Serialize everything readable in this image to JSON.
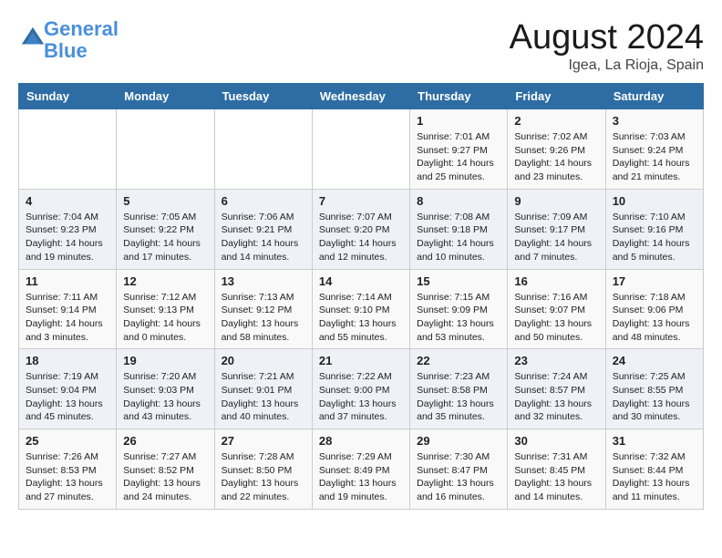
{
  "header": {
    "logo_line1": "General",
    "logo_line2": "Blue",
    "month": "August 2024",
    "location": "Igea, La Rioja, Spain"
  },
  "weekdays": [
    "Sunday",
    "Monday",
    "Tuesday",
    "Wednesday",
    "Thursday",
    "Friday",
    "Saturday"
  ],
  "weeks": [
    [
      {
        "day": "",
        "info": ""
      },
      {
        "day": "",
        "info": ""
      },
      {
        "day": "",
        "info": ""
      },
      {
        "day": "",
        "info": ""
      },
      {
        "day": "1",
        "info": "Sunrise: 7:01 AM\nSunset: 9:27 PM\nDaylight: 14 hours\nand 25 minutes."
      },
      {
        "day": "2",
        "info": "Sunrise: 7:02 AM\nSunset: 9:26 PM\nDaylight: 14 hours\nand 23 minutes."
      },
      {
        "day": "3",
        "info": "Sunrise: 7:03 AM\nSunset: 9:24 PM\nDaylight: 14 hours\nand 21 minutes."
      }
    ],
    [
      {
        "day": "4",
        "info": "Sunrise: 7:04 AM\nSunset: 9:23 PM\nDaylight: 14 hours\nand 19 minutes."
      },
      {
        "day": "5",
        "info": "Sunrise: 7:05 AM\nSunset: 9:22 PM\nDaylight: 14 hours\nand 17 minutes."
      },
      {
        "day": "6",
        "info": "Sunrise: 7:06 AM\nSunset: 9:21 PM\nDaylight: 14 hours\nand 14 minutes."
      },
      {
        "day": "7",
        "info": "Sunrise: 7:07 AM\nSunset: 9:20 PM\nDaylight: 14 hours\nand 12 minutes."
      },
      {
        "day": "8",
        "info": "Sunrise: 7:08 AM\nSunset: 9:18 PM\nDaylight: 14 hours\nand 10 minutes."
      },
      {
        "day": "9",
        "info": "Sunrise: 7:09 AM\nSunset: 9:17 PM\nDaylight: 14 hours\nand 7 minutes."
      },
      {
        "day": "10",
        "info": "Sunrise: 7:10 AM\nSunset: 9:16 PM\nDaylight: 14 hours\nand 5 minutes."
      }
    ],
    [
      {
        "day": "11",
        "info": "Sunrise: 7:11 AM\nSunset: 9:14 PM\nDaylight: 14 hours\nand 3 minutes."
      },
      {
        "day": "12",
        "info": "Sunrise: 7:12 AM\nSunset: 9:13 PM\nDaylight: 14 hours\nand 0 minutes."
      },
      {
        "day": "13",
        "info": "Sunrise: 7:13 AM\nSunset: 9:12 PM\nDaylight: 13 hours\nand 58 minutes."
      },
      {
        "day": "14",
        "info": "Sunrise: 7:14 AM\nSunset: 9:10 PM\nDaylight: 13 hours\nand 55 minutes."
      },
      {
        "day": "15",
        "info": "Sunrise: 7:15 AM\nSunset: 9:09 PM\nDaylight: 13 hours\nand 53 minutes."
      },
      {
        "day": "16",
        "info": "Sunrise: 7:16 AM\nSunset: 9:07 PM\nDaylight: 13 hours\nand 50 minutes."
      },
      {
        "day": "17",
        "info": "Sunrise: 7:18 AM\nSunset: 9:06 PM\nDaylight: 13 hours\nand 48 minutes."
      }
    ],
    [
      {
        "day": "18",
        "info": "Sunrise: 7:19 AM\nSunset: 9:04 PM\nDaylight: 13 hours\nand 45 minutes."
      },
      {
        "day": "19",
        "info": "Sunrise: 7:20 AM\nSunset: 9:03 PM\nDaylight: 13 hours\nand 43 minutes."
      },
      {
        "day": "20",
        "info": "Sunrise: 7:21 AM\nSunset: 9:01 PM\nDaylight: 13 hours\nand 40 minutes."
      },
      {
        "day": "21",
        "info": "Sunrise: 7:22 AM\nSunset: 9:00 PM\nDaylight: 13 hours\nand 37 minutes."
      },
      {
        "day": "22",
        "info": "Sunrise: 7:23 AM\nSunset: 8:58 PM\nDaylight: 13 hours\nand 35 minutes."
      },
      {
        "day": "23",
        "info": "Sunrise: 7:24 AM\nSunset: 8:57 PM\nDaylight: 13 hours\nand 32 minutes."
      },
      {
        "day": "24",
        "info": "Sunrise: 7:25 AM\nSunset: 8:55 PM\nDaylight: 13 hours\nand 30 minutes."
      }
    ],
    [
      {
        "day": "25",
        "info": "Sunrise: 7:26 AM\nSunset: 8:53 PM\nDaylight: 13 hours\nand 27 minutes."
      },
      {
        "day": "26",
        "info": "Sunrise: 7:27 AM\nSunset: 8:52 PM\nDaylight: 13 hours\nand 24 minutes."
      },
      {
        "day": "27",
        "info": "Sunrise: 7:28 AM\nSunset: 8:50 PM\nDaylight: 13 hours\nand 22 minutes."
      },
      {
        "day": "28",
        "info": "Sunrise: 7:29 AM\nSunset: 8:49 PM\nDaylight: 13 hours\nand 19 minutes."
      },
      {
        "day": "29",
        "info": "Sunrise: 7:30 AM\nSunset: 8:47 PM\nDaylight: 13 hours\nand 16 minutes."
      },
      {
        "day": "30",
        "info": "Sunrise: 7:31 AM\nSunset: 8:45 PM\nDaylight: 13 hours\nand 14 minutes."
      },
      {
        "day": "31",
        "info": "Sunrise: 7:32 AM\nSunset: 8:44 PM\nDaylight: 13 hours\nand 11 minutes."
      }
    ]
  ]
}
